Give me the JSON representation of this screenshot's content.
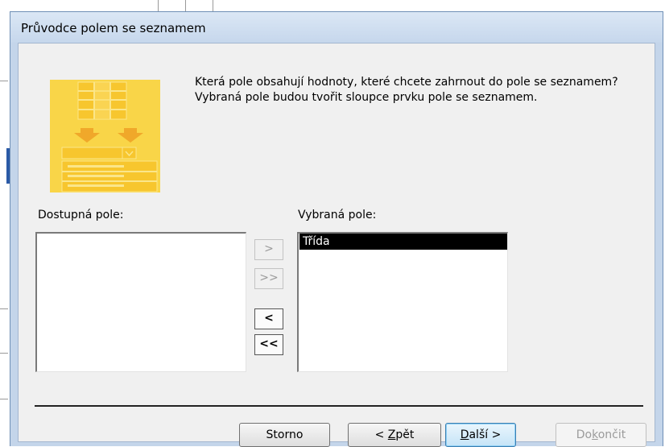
{
  "window": {
    "title": "Průvodce polem se seznamem"
  },
  "prompt": {
    "line1": "Která pole obsahují hodnoty, které chcete zahrnout do pole se seznamem?",
    "line2": "Vybraná pole budou tvořit sloupce prvku pole se seznamem."
  },
  "available": {
    "label": "Dostupná pole:",
    "items": []
  },
  "selected": {
    "label": "Vybraná pole:",
    "items": [
      "Třída"
    ]
  },
  "move_buttons": {
    "add_one": ">",
    "add_all": ">>",
    "remove_one": "<",
    "remove_all": "<<"
  },
  "footer": {
    "cancel": "Storno",
    "back_prefix": "< ",
    "back_accel": "Z",
    "back_rest": "pět",
    "next_accel": "D",
    "next_rest": "alší >",
    "finish_prefix": "Do",
    "finish_accel": "k",
    "finish_rest": "ončit"
  },
  "colors": {
    "title_bar": "#c6d7ec",
    "dialog_body": "#f0f0f0",
    "selection": "#000000",
    "wizard_image": "#f9d548"
  },
  "icons": {
    "wizard_image": "listbox-wizard-illustration"
  }
}
